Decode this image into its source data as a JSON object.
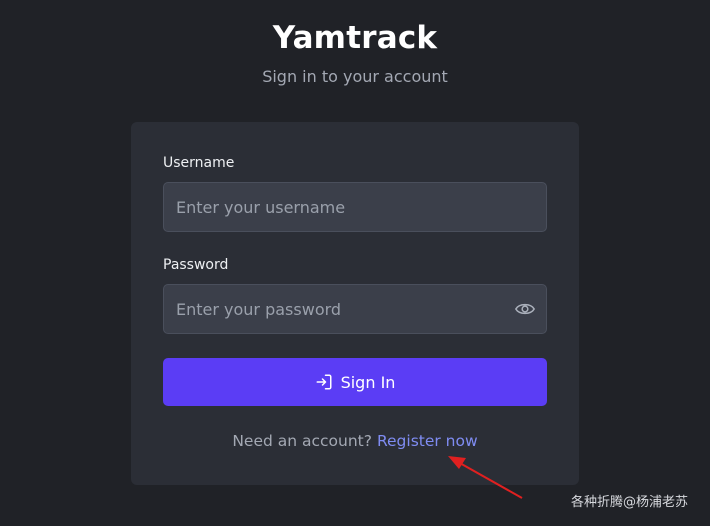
{
  "header": {
    "title": "Yamtrack",
    "subtitle": "Sign in to your account"
  },
  "form": {
    "username": {
      "label": "Username",
      "placeholder": "Enter your username",
      "value": ""
    },
    "password": {
      "label": "Password",
      "placeholder": "Enter your password",
      "value": "",
      "toggle_icon": "eye-icon"
    },
    "submit": {
      "label": "Sign In",
      "icon": "sign-in-icon"
    },
    "register": {
      "prompt": "Need an account?",
      "link_label": "Register now"
    }
  },
  "annotation": {
    "type": "red-arrow"
  },
  "watermark": "各种折腾@杨浦老苏",
  "colors": {
    "background": "#202227",
    "card": "#2b2e36",
    "input_bg": "#3b3f4a",
    "accent": "#5b3df5",
    "link": "#7f8cf2",
    "annotation": "#e02020"
  }
}
